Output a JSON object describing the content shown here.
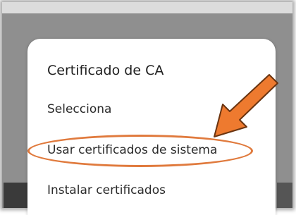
{
  "dialog": {
    "title": "Certificado de CA",
    "options": [
      {
        "label": "Selecciona"
      },
      {
        "label": "Usar certificados de sistema"
      },
      {
        "label": "Instalar certificados"
      }
    ]
  },
  "annotation": {
    "highlighted_option_index": 1,
    "color": "#e07a3d",
    "arrow_icon": "orange-arrow-icon"
  }
}
